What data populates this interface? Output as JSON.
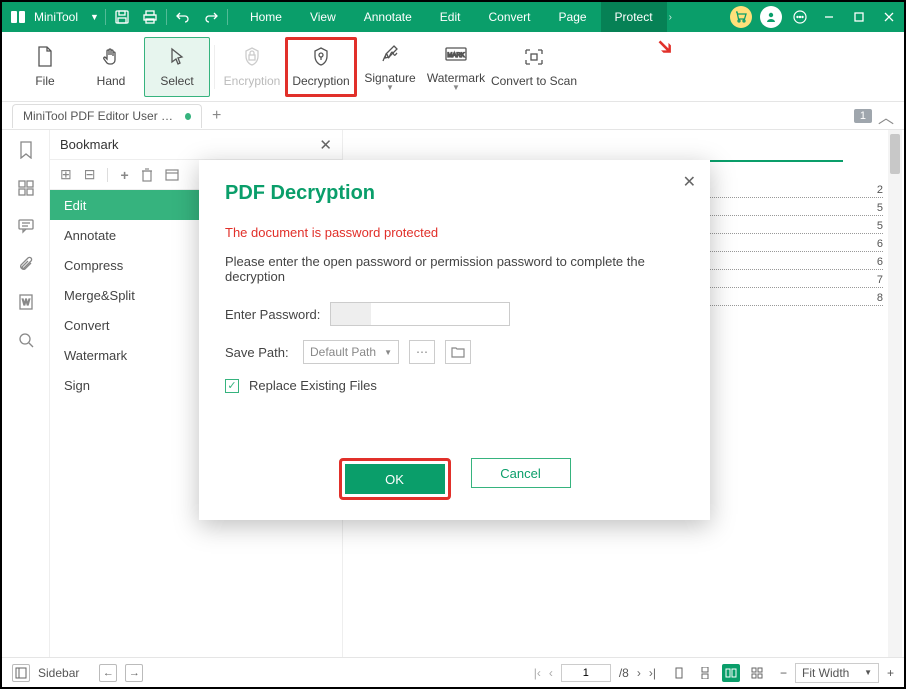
{
  "app": {
    "name": "MiniTool"
  },
  "menus": [
    "Home",
    "View",
    "Annotate",
    "Edit",
    "Convert",
    "Page",
    "Protect"
  ],
  "ribbon": {
    "file": "File",
    "hand": "Hand",
    "select": "Select",
    "encryption": "Encryption",
    "decryption": "Decryption",
    "signature": "Signature",
    "watermark": "Watermark",
    "convert_scan": "Convert to Scan"
  },
  "tab": {
    "title": "MiniTool PDF Editor User Guid..."
  },
  "tabbar": {
    "badge": "1"
  },
  "bookmark": {
    "title": "Bookmark",
    "items": [
      "Edit",
      "Annotate",
      "Compress",
      "Merge&Split",
      "Convert",
      "Watermark",
      "Sign"
    ]
  },
  "toc_pages": [
    "2",
    "5",
    "5",
    "6",
    "6",
    "7",
    "8"
  ],
  "dialog": {
    "title": "PDF Decryption",
    "warning": "The document is password protected",
    "instruction": "Please enter the open password or permission password to complete the decryption",
    "password_label": "Enter Password:",
    "savepath_label": "Save Path:",
    "default_path": "Default Path",
    "replace": "Replace Existing Files",
    "ok": "OK",
    "cancel": "Cancel"
  },
  "status": {
    "sidebar": "Sidebar",
    "page": "1",
    "total": "/8",
    "zoom": "Fit Width"
  }
}
